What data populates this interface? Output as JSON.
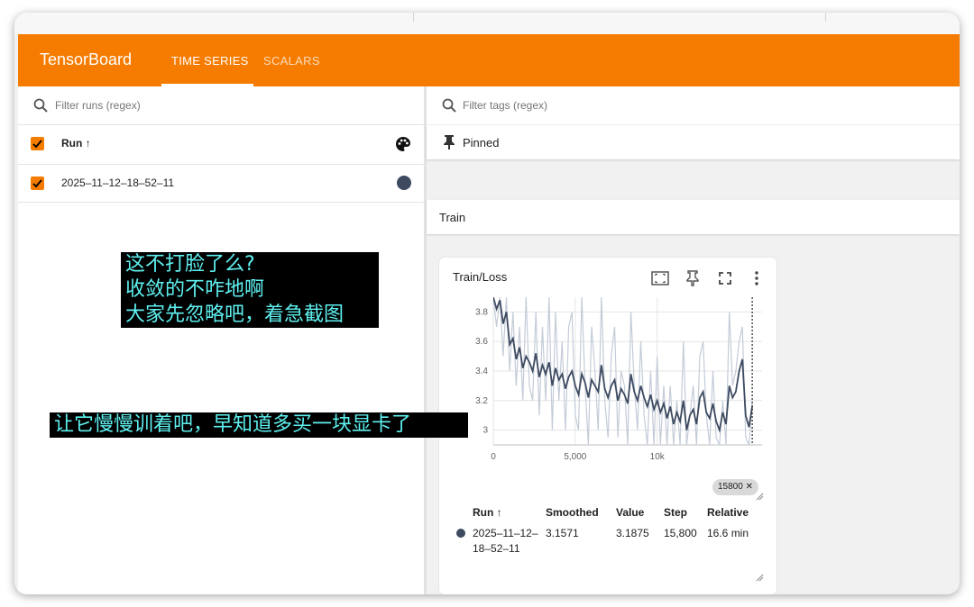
{
  "app": {
    "brand": "TensorBoard"
  },
  "tabs": [
    {
      "label": "TIME SERIES",
      "active": true
    },
    {
      "label": "SCALARS",
      "active": false
    }
  ],
  "colors": {
    "accent": "#f57c00",
    "run_color": "#3d4a60",
    "overlay_text": "#5ff0f0"
  },
  "runs_panel": {
    "filter_placeholder": "Filter runs (regex)",
    "header": "Run ↑",
    "runs": [
      {
        "name": "2025–11–12–18–52–11",
        "checked": true
      }
    ]
  },
  "tags_panel": {
    "filter_placeholder": "Filter tags (regex)",
    "pinned_label": "Pinned",
    "group_label": "Train"
  },
  "card": {
    "title": "Train/Loss",
    "step_chip": "15800",
    "table": {
      "headers": {
        "run": "Run ↑",
        "smoothed": "Smoothed",
        "value": "Value",
        "step": "Step",
        "relative": "Relative"
      },
      "row": {
        "run_line1": "2025–11–12–",
        "run_line2": "18–52–11",
        "smoothed": "3.1571",
        "value": "3.1875",
        "step": "15,800",
        "relative": "16.6 min"
      }
    }
  },
  "overlays": {
    "top_lines": [
      "这不打脸了么?",
      "收敛的不咋地啊",
      "大家先忽略吧，着急截图"
    ],
    "bottom": "让它慢慢训着吧，早知道多买一块显卡了"
  },
  "chart_data": {
    "type": "line",
    "title": "Train/Loss",
    "xlabel": "",
    "ylabel": "",
    "xlim": [
      0,
      16400
    ],
    "ylim": [
      2.9,
      3.9
    ],
    "x_ticks": [
      0,
      5000,
      10000
    ],
    "x_tick_labels": [
      "0",
      "5,000",
      "10k"
    ],
    "y_ticks": [
      3.0,
      3.2,
      3.4,
      3.6,
      3.8
    ],
    "y_tick_labels": [
      "3",
      "3.2",
      "3.4",
      "3.6",
      "3.8"
    ],
    "cursor_step": 15800,
    "series": [
      {
        "name": "2025–11–12–18–52–11",
        "style": "smoothed",
        "x": [
          0,
          200,
          400,
          600,
          800,
          1000,
          1200,
          1400,
          1600,
          1800,
          2000,
          2200,
          2400,
          2600,
          2800,
          3000,
          3200,
          3400,
          3600,
          3800,
          4000,
          4200,
          4400,
          4600,
          4800,
          5000,
          5200,
          5400,
          5600,
          5800,
          6000,
          6200,
          6400,
          6600,
          6800,
          7000,
          7200,
          7400,
          7600,
          7800,
          8000,
          8200,
          8400,
          8600,
          8800,
          9000,
          9200,
          9400,
          9600,
          9800,
          10000,
          10200,
          10400,
          10600,
          10800,
          11000,
          11200,
          11400,
          11600,
          11800,
          12000,
          12200,
          12400,
          12600,
          12800,
          13000,
          13200,
          13400,
          13600,
          13800,
          14000,
          14200,
          14400,
          14600,
          14800,
          15000,
          15200,
          15400,
          15600,
          15800
        ],
        "y": [
          3.9,
          3.82,
          3.88,
          3.72,
          3.8,
          3.58,
          3.62,
          3.48,
          3.56,
          3.42,
          3.5,
          3.46,
          3.4,
          3.52,
          3.36,
          3.44,
          3.38,
          3.46,
          3.3,
          3.42,
          3.34,
          3.38,
          3.28,
          3.36,
          3.4,
          3.3,
          3.24,
          3.38,
          3.32,
          3.22,
          3.34,
          3.3,
          3.26,
          3.44,
          3.28,
          3.22,
          3.3,
          3.34,
          3.2,
          3.28,
          3.24,
          3.18,
          3.38,
          3.26,
          3.2,
          3.3,
          3.22,
          3.16,
          3.24,
          3.14,
          3.2,
          3.12,
          3.18,
          3.08,
          3.16,
          3.04,
          3.12,
          3.06,
          3.2,
          3.0,
          3.1,
          3.14,
          3.04,
          3.22,
          3.26,
          3.12,
          3.08,
          3.18,
          3.06,
          3.0,
          3.12,
          3.04,
          3.3,
          3.22,
          3.26,
          3.4,
          3.48,
          3.1,
          3.02,
          3.16
        ]
      },
      {
        "name": "2025–11–12–18–52–11 (raw)",
        "style": "raw",
        "x": [
          0,
          200,
          400,
          600,
          800,
          1000,
          1200,
          1400,
          1600,
          1800,
          2000,
          2200,
          2400,
          2600,
          2800,
          3000,
          3200,
          3400,
          3600,
          3800,
          4000,
          4200,
          4400,
          4600,
          4800,
          5000,
          5200,
          5400,
          5600,
          5800,
          6000,
          6200,
          6400,
          6600,
          6800,
          7000,
          7200,
          7400,
          7600,
          7800,
          8000,
          8200,
          8400,
          8600,
          8800,
          9000,
          9200,
          9400,
          9600,
          9800,
          10000,
          10200,
          10400,
          10600,
          10800,
          11000,
          11200,
          11400,
          11600,
          11800,
          12000,
          12200,
          12400,
          12600,
          12800,
          13000,
          13200,
          13400,
          13600,
          13800,
          14000,
          14200,
          14400,
          14600,
          14800,
          15000,
          15200,
          15400,
          15600,
          15800
        ],
        "y": [
          3.9,
          3.7,
          3.9,
          3.5,
          3.9,
          3.4,
          3.8,
          3.3,
          3.7,
          3.2,
          3.9,
          3.3,
          3.2,
          3.8,
          3.1,
          3.7,
          3.2,
          3.9,
          3.0,
          3.8,
          3.2,
          3.6,
          3.0,
          3.7,
          3.8,
          3.1,
          3.0,
          3.9,
          3.3,
          2.9,
          3.7,
          3.4,
          3.0,
          3.9,
          3.2,
          2.95,
          3.5,
          3.7,
          2.95,
          3.4,
          3.3,
          2.9,
          3.8,
          3.3,
          3.0,
          3.6,
          3.1,
          2.9,
          3.4,
          2.9,
          3.5,
          2.9,
          3.3,
          2.9,
          3.3,
          2.9,
          3.2,
          2.9,
          3.6,
          2.9,
          3.1,
          3.3,
          2.9,
          3.5,
          3.6,
          3.1,
          2.9,
          3.4,
          2.95,
          2.9,
          3.2,
          2.9,
          3.8,
          3.3,
          3.4,
          3.6,
          3.7,
          2.95,
          2.9,
          3.2
        ]
      }
    ]
  }
}
